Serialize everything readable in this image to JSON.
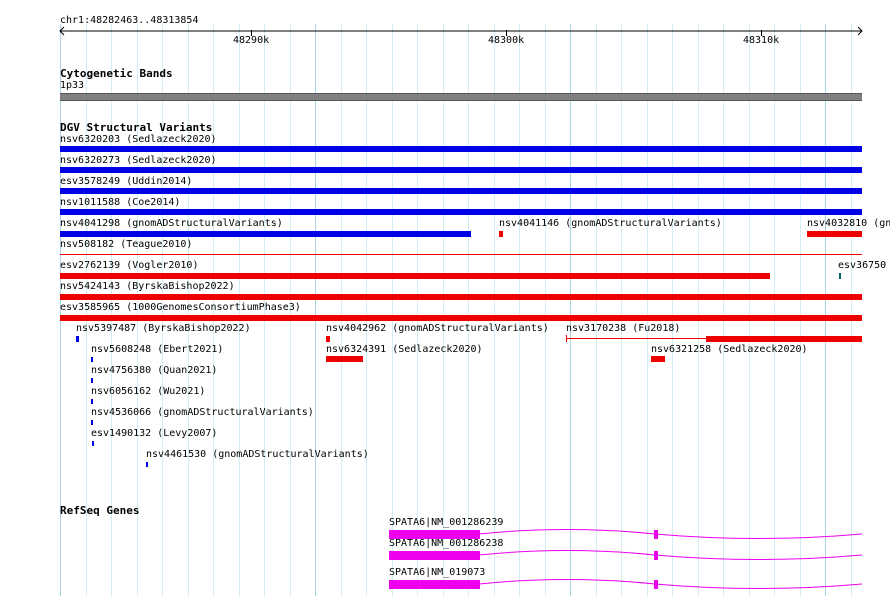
{
  "ruler": {
    "locus": "chr1:48282463..48313854",
    "ticks": [
      "48290k",
      "48300k",
      "48310k"
    ]
  },
  "cytoband": {
    "title": "Cytogenetic Bands",
    "band": "1p33"
  },
  "dgv": {
    "title": "DGV Structural Variants",
    "labels": {
      "v01": "nsv6320203 (Sedlazeck2020)",
      "v02": "nsv6320273 (Sedlazeck2020)",
      "v03": "esv3578249 (Uddin2014)",
      "v04": "nsv1011588 (Coe2014)",
      "v05": "nsv4041298 (gnomADStructuralVariants)",
      "v06": "nsv4041146 (gnomADStructuralVariants)",
      "v07": "nsv4032810 (gn",
      "v08": "nsv508182 (Teague2010)",
      "v09": "esv2762139 (Vogler2010)",
      "v10": "esv36750",
      "v11": "nsv5424143 (ByrskaBishop2022)",
      "v12": "esv3585965 (1000GenomesConsortiumPhase3)",
      "v13": "nsv5397487 (ByrskaBishop2022)",
      "v14": "nsv4042962 (gnomADStructuralVariants)",
      "v15": "nsv3170238 (Fu2018)",
      "v16": "nsv5608248 (Ebert2021)",
      "v17": "nsv6324391 (Sedlazeck2020)",
      "v18": "nsv6321258 (Sedlazeck2020)",
      "v19": "nsv4756380 (Quan2021)",
      "v20": "nsv6056162 (Wu2021)",
      "v21": "nsv4536066 (gnomADStructuralVariants)",
      "v22": "esv1490132 (Levy2007)",
      "v23": "nsv4461530 (gnomADStructuralVariants)"
    }
  },
  "refseq": {
    "title": "RefSeq Genes",
    "transcripts": [
      "SPATA6|NM_001286239",
      "SPATA6|NM_001286238",
      "SPATA6|NM_019073"
    ]
  },
  "colors": {
    "gain": "#0000e6",
    "loss": "#ee0000",
    "gene": "#ee00ee",
    "grid": "#c8e6f0",
    "band": "#808080"
  }
}
